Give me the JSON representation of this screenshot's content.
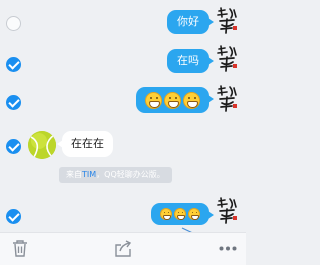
{
  "messages": [
    {
      "id": "m1",
      "direction": "out",
      "text": "你好",
      "selected": false
    },
    {
      "id": "m2",
      "direction": "out",
      "text": "在吗",
      "selected": true
    },
    {
      "id": "m3",
      "direction": "out",
      "emoji": [
        "grin-emoji",
        "grin-emoji",
        "grin-emoji"
      ],
      "selected": true
    },
    {
      "id": "m4",
      "direction": "in",
      "text": "在在在",
      "selected": true
    },
    {
      "id": "m5",
      "direction": "out",
      "emoji": [
        "grin-emoji",
        "grin-emoji",
        "grin-emoji"
      ],
      "selected": true
    }
  ],
  "system_tip": {
    "prefix": "来自",
    "app": "TIM",
    "suffix": "，QQ轻聊办公版。"
  },
  "toolbar": {
    "delete_icon": "trash-icon",
    "share_icon": "share-icon",
    "more_icon": "more-dots-icon"
  },
  "colors": {
    "bubble_out": "#2ba6ef",
    "bubble_in": "#ffffff",
    "check_selected": "#1a8ff0",
    "background": "#eef0f3",
    "tip_link": "#2a86e8"
  }
}
